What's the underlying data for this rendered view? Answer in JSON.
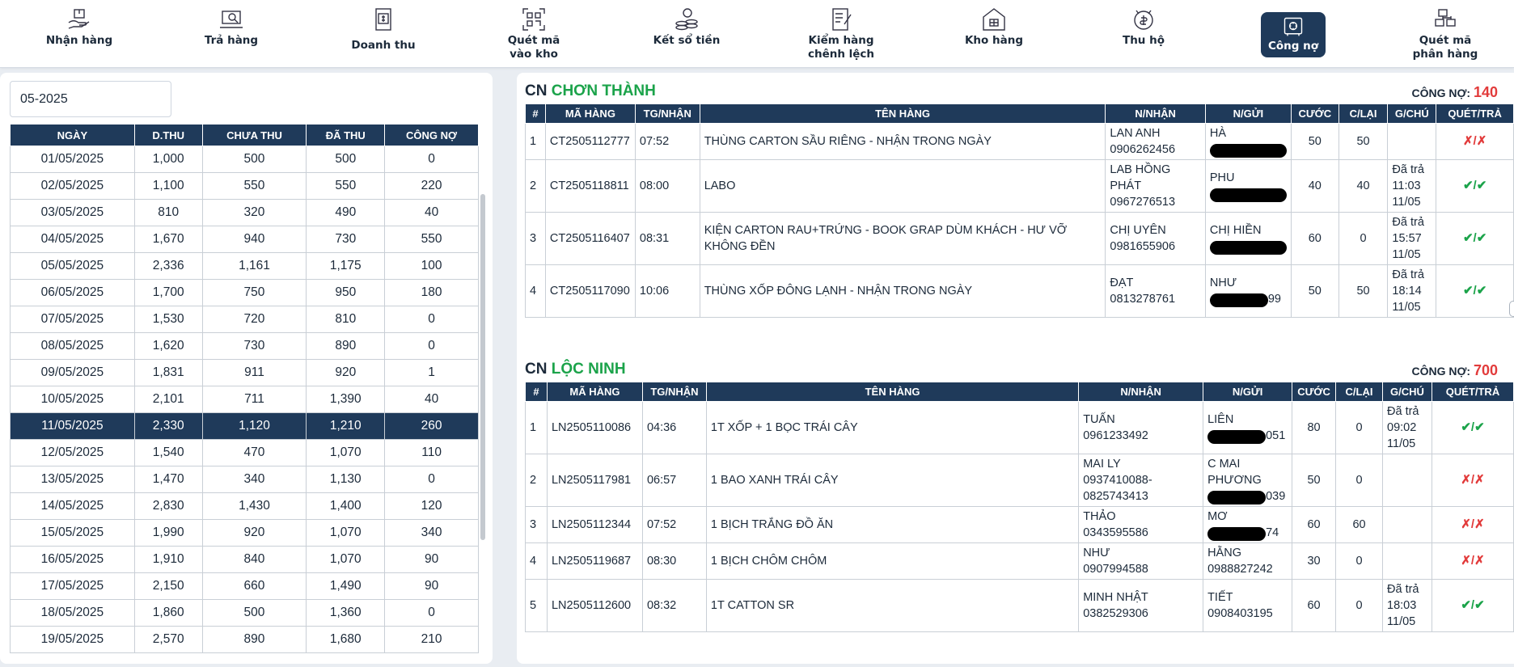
{
  "nav": [
    {
      "label": "Nhận hàng",
      "icon": "receive-package-icon"
    },
    {
      "label": "Trả hàng",
      "icon": "return-package-icon"
    },
    {
      "label": "Doanh thu",
      "icon": "revenue-icon"
    },
    {
      "label": "Quét mã\nvào kho",
      "icon": "qr-scan-icon"
    },
    {
      "label": "Kết sổ tiền",
      "icon": "coins-icon"
    },
    {
      "label": "Kiểm hàng\nchênh lệch",
      "icon": "checklist-icon"
    },
    {
      "label": "Kho hàng",
      "icon": "warehouse-icon"
    },
    {
      "label": "Thu hộ",
      "icon": "cod-collection-icon"
    },
    {
      "label": "Công nợ",
      "icon": "safe-icon",
      "active": true
    },
    {
      "label": "Quét mã\nphân hàng",
      "icon": "sort-scan-icon"
    }
  ],
  "left": {
    "month_value": "05-2025",
    "columns": [
      "NGÀY",
      "D.THU",
      "CHƯA THU",
      "ĐÃ THU",
      "CÔNG NỢ"
    ],
    "rows": [
      [
        "01/05/2025",
        "1,000",
        "500",
        "500",
        "0"
      ],
      [
        "02/05/2025",
        "1,100",
        "550",
        "550",
        "220"
      ],
      [
        "03/05/2025",
        "810",
        "320",
        "490",
        "40"
      ],
      [
        "04/05/2025",
        "1,670",
        "940",
        "730",
        "550"
      ],
      [
        "05/05/2025",
        "2,336",
        "1,161",
        "1,175",
        "100"
      ],
      [
        "06/05/2025",
        "1,700",
        "750",
        "950",
        "180"
      ],
      [
        "07/05/2025",
        "1,530",
        "720",
        "810",
        "0"
      ],
      [
        "08/05/2025",
        "1,620",
        "730",
        "890",
        "0"
      ],
      [
        "09/05/2025",
        "1,831",
        "911",
        "920",
        "1"
      ],
      [
        "10/05/2025",
        "2,101",
        "711",
        "1,390",
        "40"
      ],
      [
        "11/05/2025",
        "2,330",
        "1,120",
        "1,210",
        "260"
      ],
      [
        "12/05/2025",
        "1,540",
        "470",
        "1,070",
        "110"
      ],
      [
        "13/05/2025",
        "1,470",
        "340",
        "1,130",
        "0"
      ],
      [
        "14/05/2025",
        "2,830",
        "1,430",
        "1,400",
        "120"
      ],
      [
        "15/05/2025",
        "1,990",
        "920",
        "1,070",
        "340"
      ],
      [
        "16/05/2025",
        "1,910",
        "840",
        "1,070",
        "90"
      ],
      [
        "17/05/2025",
        "2,150",
        "660",
        "1,490",
        "90"
      ],
      [
        "18/05/2025",
        "1,860",
        "500",
        "1,360",
        "0"
      ],
      [
        "19/05/2025",
        "2,570",
        "890",
        "1,680",
        "210"
      ]
    ],
    "selected_index": 10
  },
  "branches": [
    {
      "prefix": "CN",
      "name": "CHƠN THÀNH",
      "debt_label": "CÔNG NỢ:",
      "debt_value": "140",
      "columns": [
        "#",
        "MÃ HÀNG",
        "TG/NHẬN",
        "TÊN HÀNG",
        "N/NHẬN",
        "N/GỬI",
        "CƯỚC",
        "C/LẠI",
        "G/CHÚ",
        "QUÉT/TRẢ"
      ],
      "rows": [
        {
          "no": "1",
          "code": "CT2505112777",
          "time": "07:52",
          "name": "THÙNG CARTON SẦU RIÊNG - NHẬN TRONG NGÀY",
          "receiver": "LAN ANH\n0906262456",
          "sender": "HÀ",
          "sender_tail": "",
          "fee": "50",
          "back": "50",
          "note": "",
          "scan": "x/x"
        },
        {
          "no": "2",
          "code": "CT2505118811",
          "time": "08:00",
          "name": "LABO",
          "receiver": "LAB HỒNG\nPHÁT\n0967276513",
          "sender": "PHU",
          "sender_tail": "",
          "fee": "40",
          "back": "40",
          "note": "Đã trả\n11:03\n11/05",
          "scan": "v/v"
        },
        {
          "no": "3",
          "code": "CT2505116407",
          "time": "08:31",
          "name": "KIỆN CARTON RAU+TRỨNG - BOOK GRAP DÙM KHÁCH - HƯ VỠ KHÔNG ĐỀN",
          "receiver": "CHỊ UYÊN\n0981655906",
          "sender": "CHỊ HIỀN",
          "sender_tail": "",
          "fee": "60",
          "back": "0",
          "note": "Đã trả\n15:57\n11/05",
          "scan": "v/v"
        },
        {
          "no": "4",
          "code": "CT2505117090",
          "time": "10:06",
          "name": "THÙNG XỐP ĐÔNG LẠNH - NHẬN TRONG NGÀY",
          "receiver": "ĐẠT\n0813278761",
          "sender": "NHƯ",
          "sender_tail": "99",
          "fee": "50",
          "back": "50",
          "note": "Đã trả\n18:14\n11/05",
          "scan": "v/v"
        }
      ]
    },
    {
      "prefix": "CN",
      "name": "LỘC NINH",
      "debt_label": "CÔNG NỢ:",
      "debt_value": "700",
      "columns": [
        "#",
        "MÃ HÀNG",
        "TG/NHẬN",
        "TÊN HÀNG",
        "N/NHẬN",
        "N/GỬI",
        "CƯỚC",
        "C/LẠI",
        "G/CHÚ",
        "QUÉT/TRẢ"
      ],
      "rows": [
        {
          "no": "1",
          "code": "LN2505110086",
          "time": "04:36",
          "name": "1T XỐP + 1 BỌC TRÁI CÂY",
          "receiver": "TUẤN\n0961233492",
          "sender": "LIÊN",
          "sender_tail": "051",
          "fee": "80",
          "back": "0",
          "note": "Đã trả\n09:02\n11/05",
          "scan": "v/v"
        },
        {
          "no": "2",
          "code": "LN2505117981",
          "time": "06:57",
          "name": "1 BAO XANH TRÁI CÂY",
          "receiver": "MAI LY\n0937410088-\n0825743413",
          "sender": "C MAI\nPHƯƠNG",
          "sender_tail": "039",
          "fee": "50",
          "back": "0",
          "note": "",
          "scan": "x/x"
        },
        {
          "no": "3",
          "code": "LN2505112344",
          "time": "07:52",
          "name": "1 BỊCH TRẮNG ĐỒ ĂN",
          "receiver": "THẢO\n0343595586",
          "sender": "MƠ",
          "sender_tail": "74",
          "fee": "60",
          "back": "60",
          "note": "",
          "scan": "x/x"
        },
        {
          "no": "4",
          "code": "LN2505119687",
          "time": "08:30",
          "name": "1 BỊCH CHÔM CHÔM",
          "receiver": "NHƯ\n0907994588",
          "sender": "HẰNG\n0988827242",
          "sender_tail": "",
          "fee": "30",
          "back": "0",
          "note": "",
          "scan": "x/x"
        },
        {
          "no": "5",
          "code": "LN2505112600",
          "time": "08:32",
          "name": "1T CATTON SR",
          "receiver": "MINH NHẬT\n0382529306",
          "sender": "TIẾT\n0908403195",
          "sender_tail": "",
          "fee": "60",
          "back": "0",
          "note": "Đã trả\n18:03\n11/05",
          "scan": "v/v"
        }
      ]
    }
  ],
  "colors": {
    "navy": "#1f3a5a",
    "green": "#1ba34a",
    "red": "#e23b3b"
  }
}
